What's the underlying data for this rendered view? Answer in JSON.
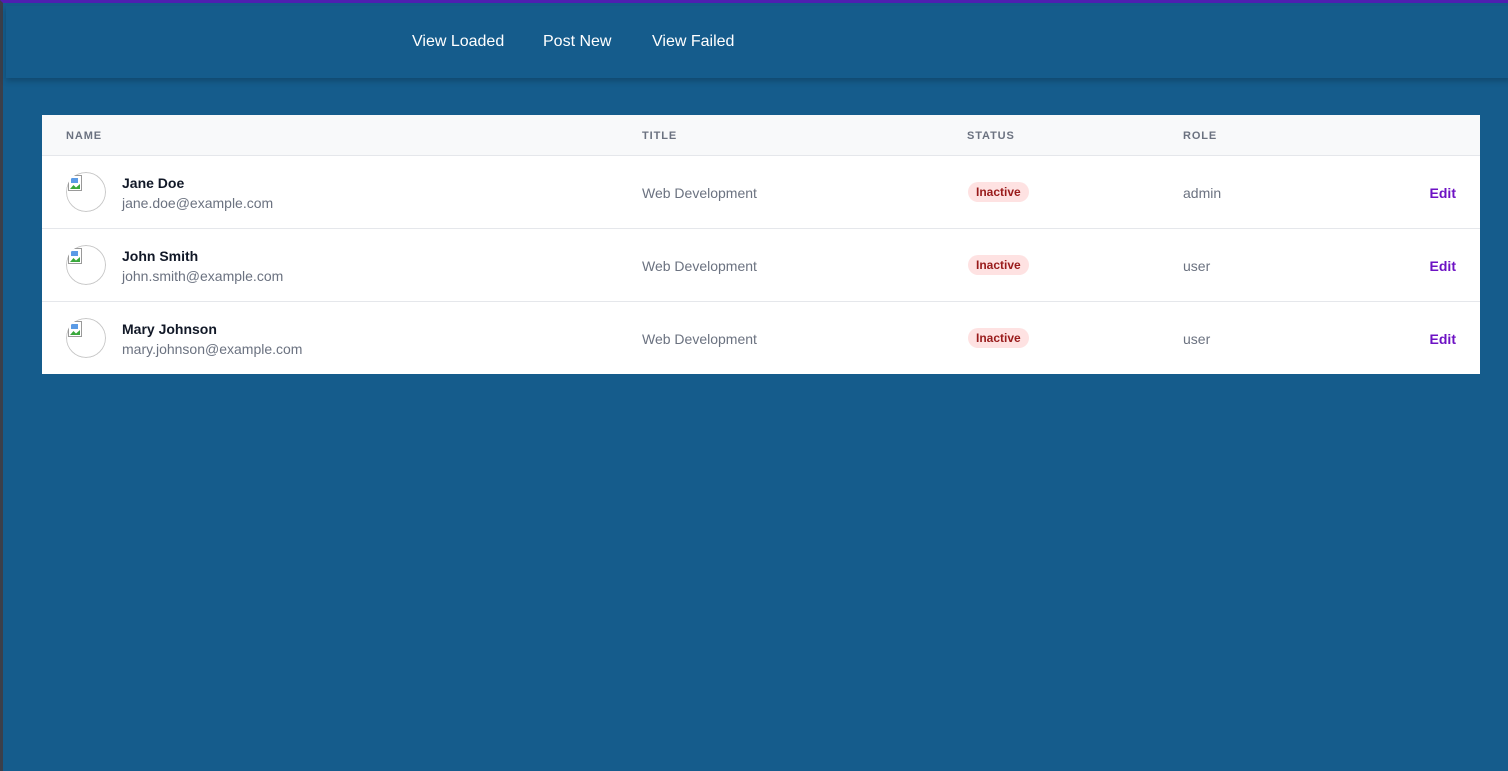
{
  "nav": {
    "links": [
      "View Loaded",
      "Post New",
      "View Failed"
    ]
  },
  "table": {
    "headers": {
      "name": "Name",
      "title": "Title",
      "status": "Status",
      "role": "Role"
    },
    "rows": [
      {
        "name": "Jane Doe",
        "email": "jane.doe@example.com",
        "title": "Web Development",
        "status": "Inactive",
        "role": "admin",
        "action": "Edit"
      },
      {
        "name": "John Smith",
        "email": "john.smith@example.com",
        "title": "Web Development",
        "status": "Inactive",
        "role": "user",
        "action": "Edit"
      },
      {
        "name": "Mary Johnson",
        "email": "mary.johnson@example.com",
        "title": "Web Development",
        "status": "Inactive",
        "role": "user",
        "action": "Edit"
      }
    ]
  },
  "colors": {
    "background": "#155c8c",
    "status_badge_bg": "#fee2e2",
    "status_badge_text": "#991b1b",
    "action_link": "#6d12c4"
  },
  "icons": {
    "avatar": "broken-image-icon"
  }
}
